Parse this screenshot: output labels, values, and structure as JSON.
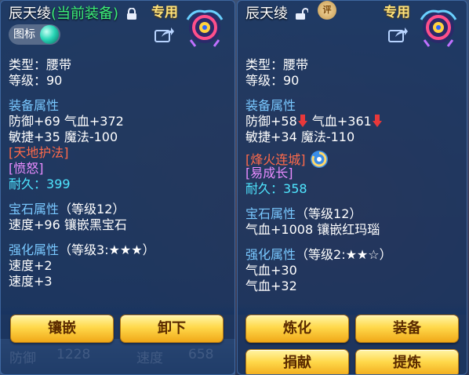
{
  "background": {
    "stat_label": "防御",
    "stat_value": "1228",
    "speed_label": "速度",
    "speed_value": "658"
  },
  "left": {
    "name": "辰天绫",
    "status": "(当前装备)",
    "special": "专用",
    "tag_label": "图标",
    "type_line": "类型：腰带",
    "level_line": "等级：90",
    "attr_header": "装备属性",
    "attr_line1": "防御+69 气血+372",
    "attr_line2": "敏捷+35 魔法-100",
    "special_skill": "[天地护法]",
    "effect": "[愤怒]",
    "durability_label": "耐久：",
    "durability_value": "399",
    "gem_header": "宝石属性",
    "gem_level": "（等级12）",
    "gem_line": "速度+96 镶嵌黑宝石",
    "enh_header": "强化属性",
    "enh_level": "（等级3:★★★）",
    "enh_line1": "速度+2",
    "enh_line2": "速度+3",
    "btn_inlay": "镶嵌",
    "btn_unequip": "卸下"
  },
  "right": {
    "name": "辰天绫",
    "special": "专用",
    "seal_text": "评",
    "type_line": "类型：腰带",
    "level_line": "等级：90",
    "attr_header": "装备属性",
    "attr_line1a": "防御+58",
    "attr_line1b": "气血+361",
    "attr_line2": "敏捷+34 魔法-110",
    "special_skill": "[烽火连城]",
    "effect": "[易成长]",
    "durability_label": "耐久：",
    "durability_value": "358",
    "gem_header": "宝石属性",
    "gem_level": "（等级12）",
    "gem_line": "气血+1008 镶嵌红玛瑙",
    "enh_header": "强化属性",
    "enh_level": "（等级2:★★☆）",
    "enh_line1": "气血+30",
    "enh_line2": "气血+32",
    "btn_refine": "炼化",
    "btn_equip": "装备",
    "btn_donate": "捐献",
    "btn_purify": "提炼"
  },
  "colors": {
    "accent_green": "#3cf07a",
    "header_blue": "#79c8ff",
    "skill_red": "#ff6a4a",
    "effect_pink": "#e98cff",
    "durability_cyan": "#4fe6ff",
    "button_gold": "#ffd84a"
  },
  "icons": [
    "lock-icon",
    "unlock-icon",
    "share-icon",
    "belt-item-icon",
    "orb-icon",
    "swirl-icon",
    "down-arrow-icon"
  ]
}
